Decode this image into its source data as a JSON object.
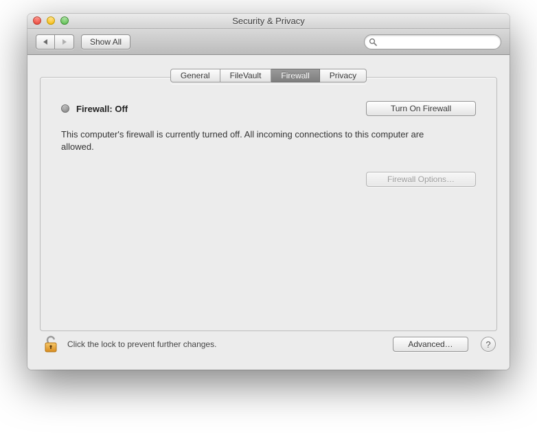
{
  "window": {
    "title": "Security & Privacy"
  },
  "toolbar": {
    "show_all_label": "Show All",
    "search_placeholder": ""
  },
  "tabs": {
    "general": "General",
    "filevault": "FileVault",
    "firewall": "Firewall",
    "privacy": "Privacy",
    "active": "firewall"
  },
  "firewall": {
    "status_label": "Firewall: Off",
    "turn_on_label": "Turn On Firewall",
    "description": "This computer's firewall is currently turned off. All incoming connections to this computer are allowed.",
    "options_label": "Firewall Options…"
  },
  "footer": {
    "lock_text": "Click the lock to prevent further changes.",
    "advanced_label": "Advanced…",
    "help_label": "?"
  }
}
